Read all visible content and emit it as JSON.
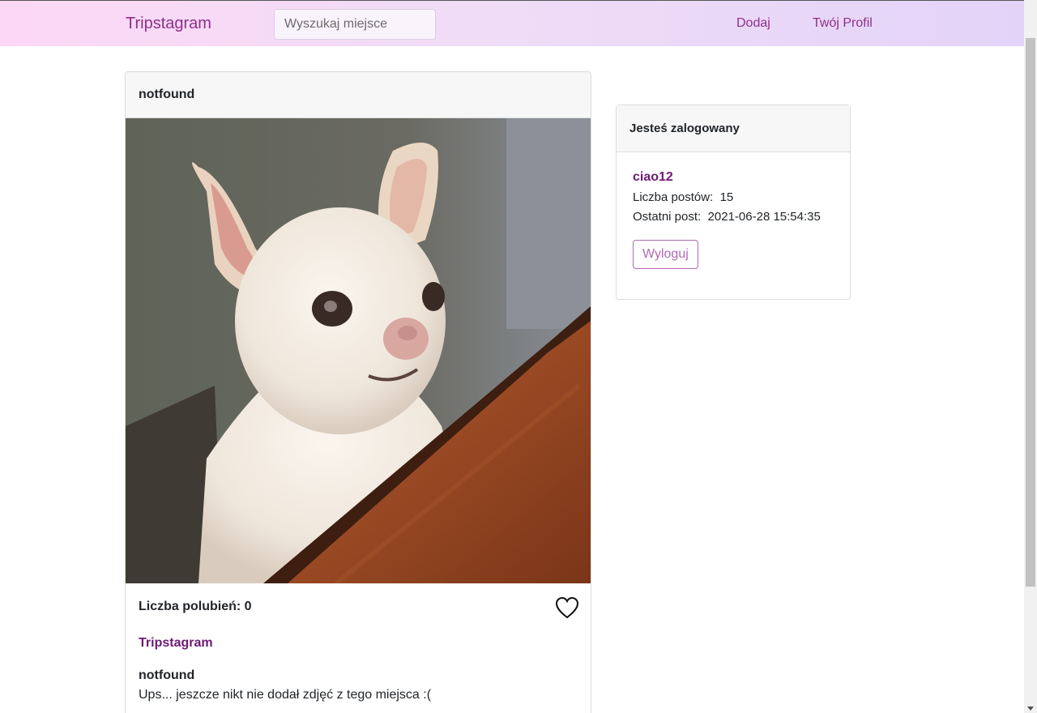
{
  "navbar": {
    "brand": "Tripstagram",
    "search_placeholder": "Wyszukaj miejsce",
    "add_label": "Dodaj",
    "profile_label": "Twój Profil"
  },
  "post": {
    "header_title": "notfound",
    "likes_label": "Liczba polubień: 0",
    "place": "Tripstagram",
    "author": "notfound",
    "text": "Ups... jeszcze nikt nie dodał zdjęć z tego miejsca :("
  },
  "sidebar": {
    "header": "Jesteś zalogowany",
    "username": "ciao12",
    "posts_label": "Liczba postów:",
    "posts_count": "15",
    "last_post_label": "Ostatni post:",
    "last_post_date": "2021-06-28 15:54:35",
    "logout_label": "Wyloguj"
  },
  "colors": {
    "accent": "#8e2f8a",
    "link": "#6f1a73",
    "logout_border": "#b06ab3"
  }
}
